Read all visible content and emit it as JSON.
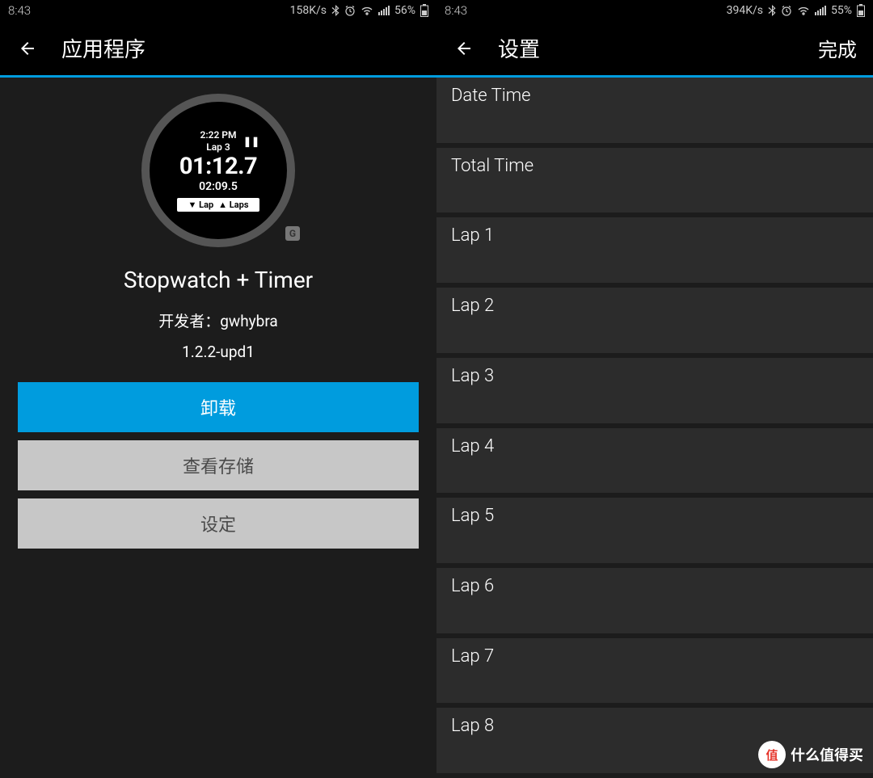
{
  "left": {
    "status": {
      "time": "8:43",
      "speed": "158K/s",
      "battery": "56%"
    },
    "header": {
      "title": "应用程序"
    },
    "watchface": {
      "time": "2:22 PM",
      "lap_label": "Lap 3",
      "main_time": "01:12.7",
      "sub_time": "02:09.5",
      "tab_lap": "Lap",
      "tab_laps": "Laps",
      "badge": "G"
    },
    "app": {
      "name": "Stopwatch + Timer",
      "dev_prefix": "开发者：",
      "dev_name": "gwhybra",
      "version": "1.2.2-upd1"
    },
    "buttons": {
      "uninstall": "卸载",
      "view_storage": "查看存储",
      "settings": "设定"
    }
  },
  "right": {
    "status": {
      "time": "8:43",
      "speed": "394K/s",
      "battery": "55%"
    },
    "header": {
      "title": "设置",
      "done": "完成"
    },
    "settings": [
      {
        "label": "Date Time"
      },
      {
        "label": "Total Time"
      },
      {
        "label": "Lap 1"
      },
      {
        "label": "Lap 2"
      },
      {
        "label": "Lap 3"
      },
      {
        "label": "Lap 4"
      },
      {
        "label": "Lap 5"
      },
      {
        "label": "Lap 6"
      },
      {
        "label": "Lap 7"
      },
      {
        "label": "Lap 8"
      }
    ]
  },
  "watermark": {
    "text": "什么值得买",
    "badge": "值"
  }
}
